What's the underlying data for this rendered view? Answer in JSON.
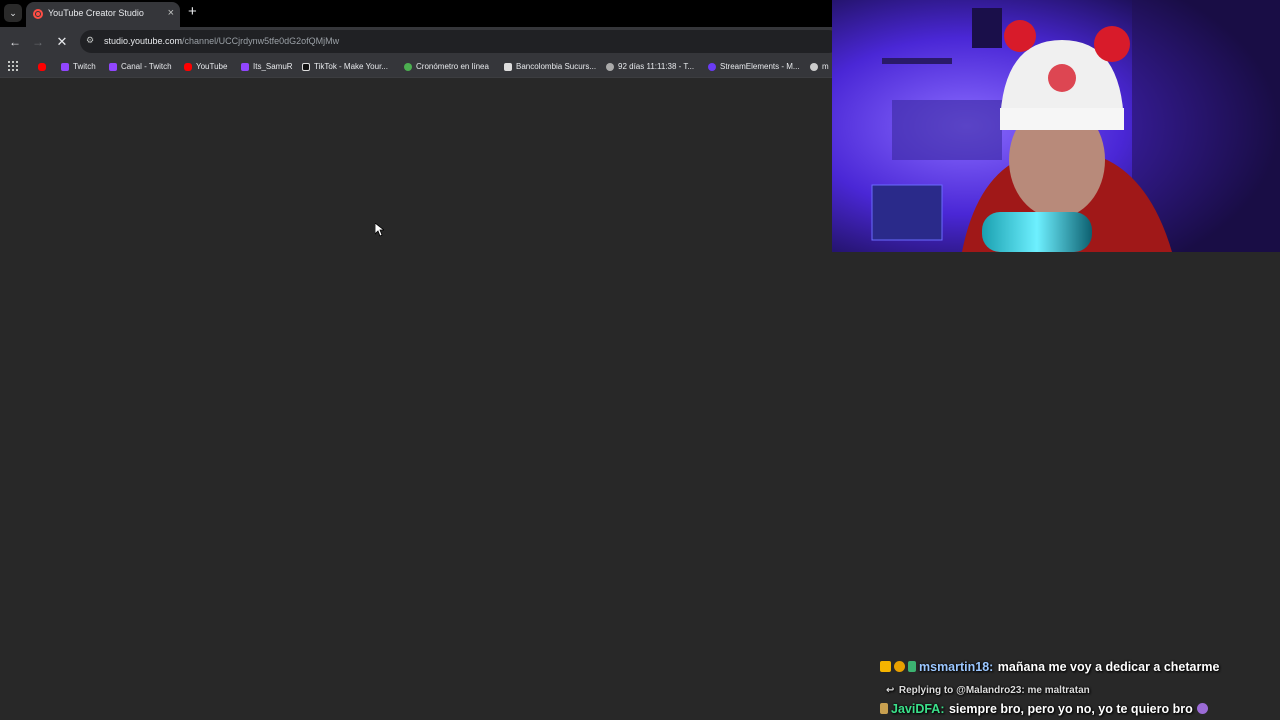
{
  "browser": {
    "tab": {
      "title": "YouTube Creator Studio",
      "close_icon": "×"
    },
    "new_tab_icon": "+",
    "toolbar": {
      "url_host": "studio.youtube.com",
      "url_path": "/channel/UCCjrdynw5tfe0dG2ofQMjMw",
      "loading": true
    },
    "bookmarks": [
      {
        "label": "",
        "icon": "youtube-icon",
        "color": "#ff0000"
      },
      {
        "label": "Twitch",
        "icon": "twitch-icon",
        "color": "#9146ff"
      },
      {
        "label": "Canal - Twitch",
        "icon": "twitch-icon",
        "color": "#9146ff"
      },
      {
        "label": "YouTube",
        "icon": "youtube-icon",
        "color": "#ff0000"
      },
      {
        "label": "Its_SamuR",
        "icon": "twitch-icon",
        "color": "#9146ff"
      },
      {
        "label": "TikTok - Make Your...",
        "icon": "tiktok-icon",
        "color": "#ffffff"
      },
      {
        "label": "Cronómetro en línea",
        "icon": "stopwatch-icon",
        "color": "#4caf50"
      },
      {
        "label": "Bancolombia Sucurs...",
        "icon": "bancolombia-icon",
        "color": "#dddddd"
      },
      {
        "label": "92 días 11:11:38 - T...",
        "icon": "countdown-icon",
        "color": "#aaaaaa"
      },
      {
        "label": "StreamElements - M...",
        "icon": "streamelements-icon",
        "color": "#6a3bf5"
      },
      {
        "label": "m",
        "icon": "google-icon",
        "color": "#cccccc"
      }
    ]
  },
  "chat": {
    "messages": [
      {
        "user": "msmartin18:",
        "user_color": "#9bc7ff",
        "text": "mañana me voy a dedicar a chetarme"
      },
      {
        "reply_label": "Replying to @Malandro23: me maltratan"
      },
      {
        "user": "JaviDFA:",
        "user_color": "#3be08a",
        "text": "siempre bro, pero yo no, yo te quiero bro"
      }
    ]
  }
}
